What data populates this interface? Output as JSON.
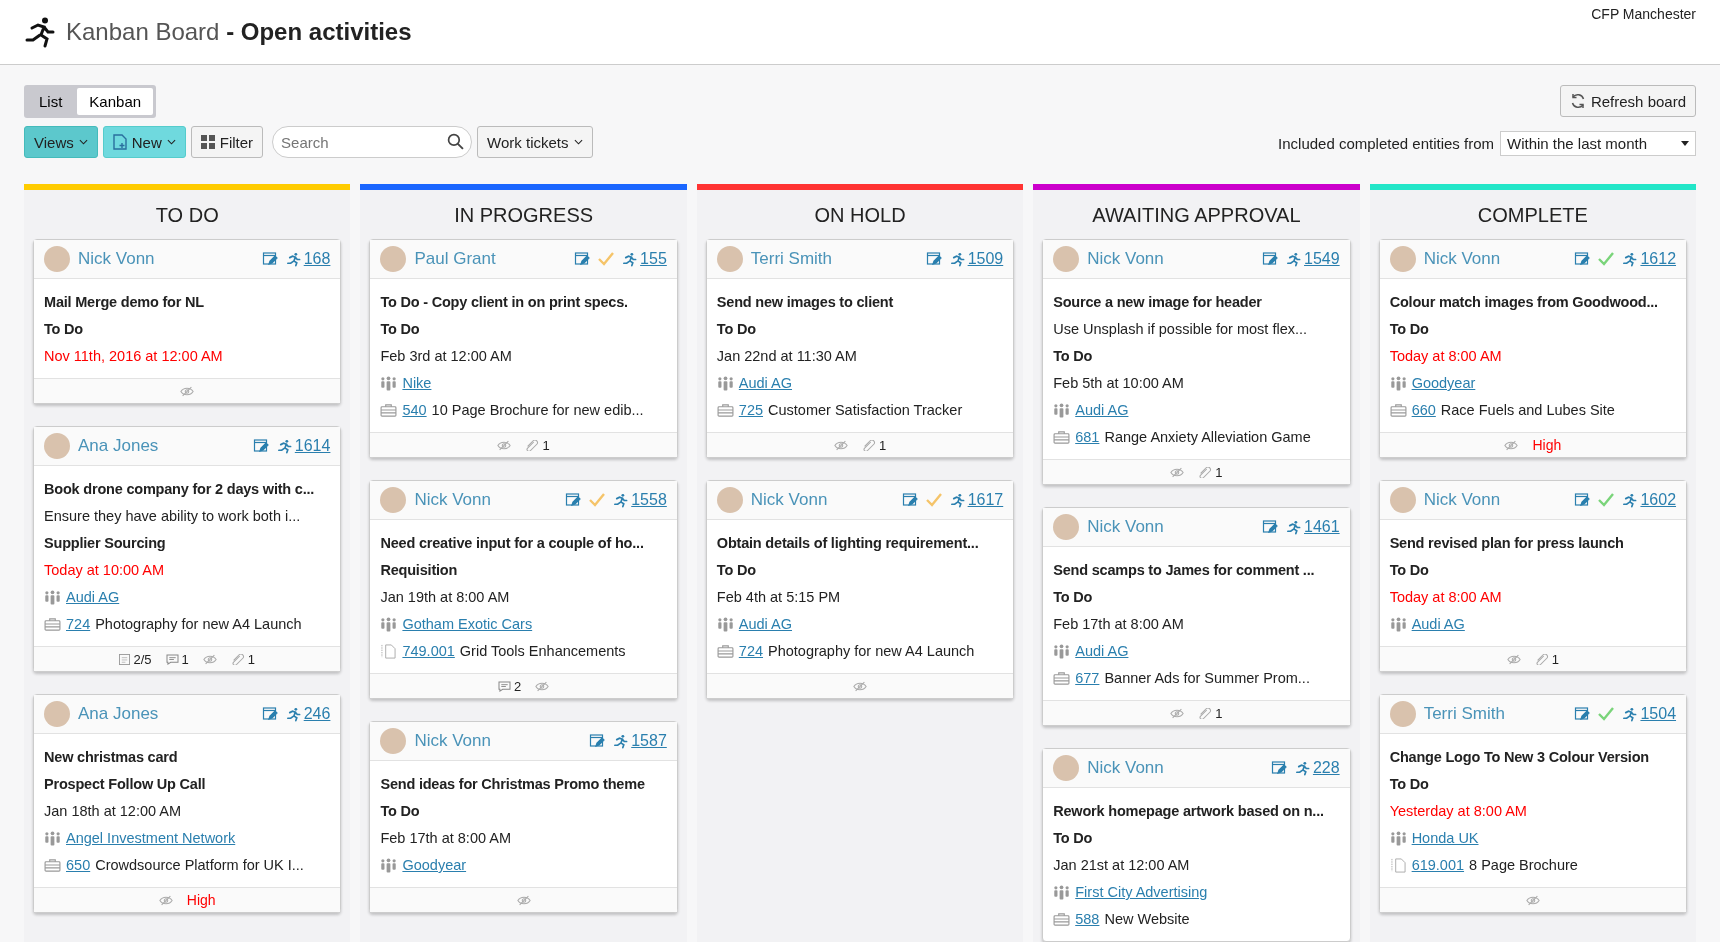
{
  "header": {
    "title": "Kanban Board **- Open activities**",
    "account": "CFP Manchester"
  },
  "view_tabs": [
    {
      "label": "List",
      "selected": false
    },
    {
      "label": "Kanban",
      "selected": true
    }
  ],
  "toolbar": {
    "views": "Views",
    "new": "New",
    "filter": "Filter",
    "search": {
      "placeholder": "Search"
    },
    "type_filter": "Work tickets",
    "refresh": "Refresh board",
    "range_label": "Included completed entities from",
    "range_value": "Within the last month"
  },
  "columns": [
    {
      "title": "TO DO",
      "color": "#ffcc00",
      "cards": [
        {
          "person": "Nick Vonn",
          "checked": false,
          "id": "168",
          "lines": [
            {
              "kind": "title",
              "text": "Mail Merge demo for NL"
            },
            {
              "kind": "type",
              "text": "To Do"
            },
            {
              "kind": "date",
              "text": "Nov 11th, 2016 at 12:00 AM",
              "overdue": true
            }
          ],
          "footer": [
            {
              "kind": "hidden"
            }
          ]
        },
        {
          "person": "Ana Jones",
          "checked": false,
          "id": "1614",
          "lines": [
            {
              "kind": "title",
              "text": "Book drone company for 2 days with c..."
            },
            {
              "kind": "note",
              "text": "Ensure they have ability to work both i..."
            },
            {
              "kind": "type",
              "text": "Supplier Sourcing"
            },
            {
              "kind": "date",
              "text": "Today at 10:00 AM",
              "overdue": true
            },
            {
              "kind": "company",
              "text": "Audi AG"
            },
            {
              "kind": "project",
              "ref": "724",
              "text": "Photography for new A4 Launch"
            }
          ],
          "footer": [
            {
              "kind": "checklist",
              "text": "2/5"
            },
            {
              "kind": "comments",
              "text": "1"
            },
            {
              "kind": "hidden"
            },
            {
              "kind": "attachments",
              "text": "1"
            }
          ]
        },
        {
          "person": "Ana Jones",
          "checked": false,
          "id": "246",
          "lines": [
            {
              "kind": "title",
              "text": "New christmas card"
            },
            {
              "kind": "type",
              "text": "Prospect Follow Up Call"
            },
            {
              "kind": "date",
              "text": "Jan 18th at 12:00 AM",
              "overdue": false
            },
            {
              "kind": "company",
              "text": "Angel Investment Network"
            },
            {
              "kind": "project",
              "ref": "650",
              "text": "Crowdsource Platform for UK I..."
            }
          ],
          "footer": [
            {
              "kind": "hidden"
            },
            {
              "kind": "priority",
              "text": "High"
            }
          ]
        }
      ]
    },
    {
      "title": "IN PROGRESS",
      "color": "#1a66ff",
      "cards": [
        {
          "person": "Paul Grant",
          "checked": true,
          "check": {
            "color": "#f5c469"
          },
          "id": "155",
          "lines": [
            {
              "kind": "title",
              "text": "To Do - Copy client in on print specs."
            },
            {
              "kind": "type",
              "text": "To Do"
            },
            {
              "kind": "date",
              "text": "Feb 3rd at 12:00 AM",
              "overdue": false
            },
            {
              "kind": "company",
              "text": "Nike"
            },
            {
              "kind": "project",
              "ref": "540",
              "text": "10 Page Brochure for new edib..."
            }
          ],
          "footer": [
            {
              "kind": "hidden"
            },
            {
              "kind": "attachments",
              "text": "1"
            }
          ]
        },
        {
          "person": "Nick Vonn",
          "checked": true,
          "check": {
            "color": "#f5c469"
          },
          "id": "1558",
          "lines": [
            {
              "kind": "title",
              "text": "Need creative input for a couple of ho..."
            },
            {
              "kind": "type",
              "text": "Requisition"
            },
            {
              "kind": "date",
              "text": "Jan 19th at 8:00 AM",
              "overdue": false
            },
            {
              "kind": "company",
              "text": "Gotham Exotic Cars"
            },
            {
              "kind": "subtask",
              "ref": "749.001",
              "text": "Grid Tools Enhancements"
            }
          ],
          "footer": [
            {
              "kind": "comments",
              "text": "2"
            },
            {
              "kind": "hidden"
            }
          ]
        },
        {
          "person": "Nick Vonn",
          "checked": false,
          "id": "1587",
          "lines": [
            {
              "kind": "title",
              "text": "Send ideas for Christmas Promo theme"
            },
            {
              "kind": "type",
              "text": "To Do"
            },
            {
              "kind": "date",
              "text": "Feb 17th at 8:00 AM",
              "overdue": false
            },
            {
              "kind": "company",
              "text": "Goodyear"
            }
          ],
          "footer": [
            {
              "kind": "hidden"
            }
          ]
        }
      ]
    },
    {
      "title": "ON HOLD",
      "color": "#ff3333",
      "cards": [
        {
          "person": "Terri Smith",
          "checked": false,
          "id": "1509",
          "lines": [
            {
              "kind": "title",
              "text": "Send new images to client"
            },
            {
              "kind": "type",
              "text": "To Do"
            },
            {
              "kind": "date",
              "text": "Jan 22nd at 11:30 AM",
              "overdue": false
            },
            {
              "kind": "company",
              "text": "Audi AG"
            },
            {
              "kind": "project",
              "ref": "725",
              "text": "Customer Satisfaction Tracker"
            }
          ],
          "footer": [
            {
              "kind": "hidden"
            },
            {
              "kind": "attachments",
              "text": "1"
            }
          ]
        },
        {
          "person": "Nick Vonn",
          "checked": true,
          "check": {
            "color": "#f5c469"
          },
          "id": "1617",
          "lines": [
            {
              "kind": "title",
              "text": "Obtain details of lighting requirement..."
            },
            {
              "kind": "type",
              "text": "To Do"
            },
            {
              "kind": "date",
              "text": "Feb 4th at 5:15 PM",
              "overdue": false
            },
            {
              "kind": "company",
              "text": "Audi AG"
            },
            {
              "kind": "project",
              "ref": "724",
              "text": "Photography for new A4 Launch"
            }
          ],
          "footer": [
            {
              "kind": "hidden"
            }
          ]
        }
      ]
    },
    {
      "title": "AWAITING APPROVAL",
      "color": "#cc00cc",
      "cards": [
        {
          "person": "Nick Vonn",
          "checked": false,
          "id": "1549",
          "lines": [
            {
              "kind": "title",
              "text": "Source a new image for header"
            },
            {
              "kind": "note",
              "text": "Use Unsplash if possible for most flex..."
            },
            {
              "kind": "type",
              "text": "To Do"
            },
            {
              "kind": "date",
              "text": "Feb 5th at 10:00 AM",
              "overdue": false
            },
            {
              "kind": "company",
              "text": "Audi AG"
            },
            {
              "kind": "project",
              "ref": "681",
              "text": "Range Anxiety Alleviation Game"
            }
          ],
          "footer": [
            {
              "kind": "hidden"
            },
            {
              "kind": "attachments",
              "text": "1"
            }
          ]
        },
        {
          "person": "Nick Vonn",
          "checked": false,
          "id": "1461",
          "lines": [
            {
              "kind": "title",
              "text": "Send scamps to James for comment ..."
            },
            {
              "kind": "type",
              "text": "To Do"
            },
            {
              "kind": "date",
              "text": "Feb 17th at 8:00 AM",
              "overdue": false
            },
            {
              "kind": "company",
              "text": "Audi AG"
            },
            {
              "kind": "project",
              "ref": "677",
              "text": "Banner Ads for Summer Prom..."
            }
          ],
          "footer": [
            {
              "kind": "hidden"
            },
            {
              "kind": "attachments",
              "text": "1"
            }
          ]
        },
        {
          "person": "Nick Vonn",
          "checked": false,
          "id": "228",
          "lines": [
            {
              "kind": "title",
              "text": "Rework homepage artwork based on n..."
            },
            {
              "kind": "type",
              "text": "To Do"
            },
            {
              "kind": "date",
              "text": "Jan 21st at 12:00 AM",
              "overdue": false
            },
            {
              "kind": "company",
              "text": "First City Advertising"
            },
            {
              "kind": "project",
              "ref": "588",
              "text": "New Website"
            }
          ]
        }
      ]
    },
    {
      "title": "COMPLETE",
      "color": "#22e6c8",
      "cards": [
        {
          "person": "Nick Vonn",
          "checked": true,
          "check": {
            "color": "#7ad47a"
          },
          "id": "1612",
          "lines": [
            {
              "kind": "title",
              "text": "Colour match images from Goodwood..."
            },
            {
              "kind": "type",
              "text": "To Do"
            },
            {
              "kind": "date",
              "text": "Today at 8:00 AM",
              "overdue": true
            },
            {
              "kind": "company",
              "text": "Goodyear"
            },
            {
              "kind": "project",
              "ref": "660",
              "text": "Race Fuels and Lubes Site"
            }
          ],
          "footer": [
            {
              "kind": "hidden"
            },
            {
              "kind": "priority",
              "text": "High"
            }
          ]
        },
        {
          "person": "Nick Vonn",
          "checked": true,
          "check": {
            "color": "#7ad47a"
          },
          "id": "1602",
          "lines": [
            {
              "kind": "title",
              "text": "Send revised plan for press launch"
            },
            {
              "kind": "type",
              "text": "To Do"
            },
            {
              "kind": "date",
              "text": "Today at 8:00 AM",
              "overdue": true
            },
            {
              "kind": "company",
              "text": "Audi AG"
            }
          ],
          "footer": [
            {
              "kind": "hidden"
            },
            {
              "kind": "attachments",
              "text": "1"
            }
          ]
        },
        {
          "person": "Terri Smith",
          "checked": true,
          "check": {
            "color": "#7ad47a"
          },
          "id": "1504",
          "lines": [
            {
              "kind": "title",
              "text": "Change Logo To New 3 Colour Version"
            },
            {
              "kind": "type",
              "text": "To Do"
            },
            {
              "kind": "date",
              "text": "Yesterday at 8:00 AM",
              "overdue": true
            },
            {
              "kind": "company",
              "text": "Honda UK"
            },
            {
              "kind": "subtask",
              "ref": "619.001",
              "text": "8 Page Brochure"
            }
          ],
          "footer": [
            {
              "kind": "hidden"
            }
          ]
        }
      ]
    }
  ]
}
